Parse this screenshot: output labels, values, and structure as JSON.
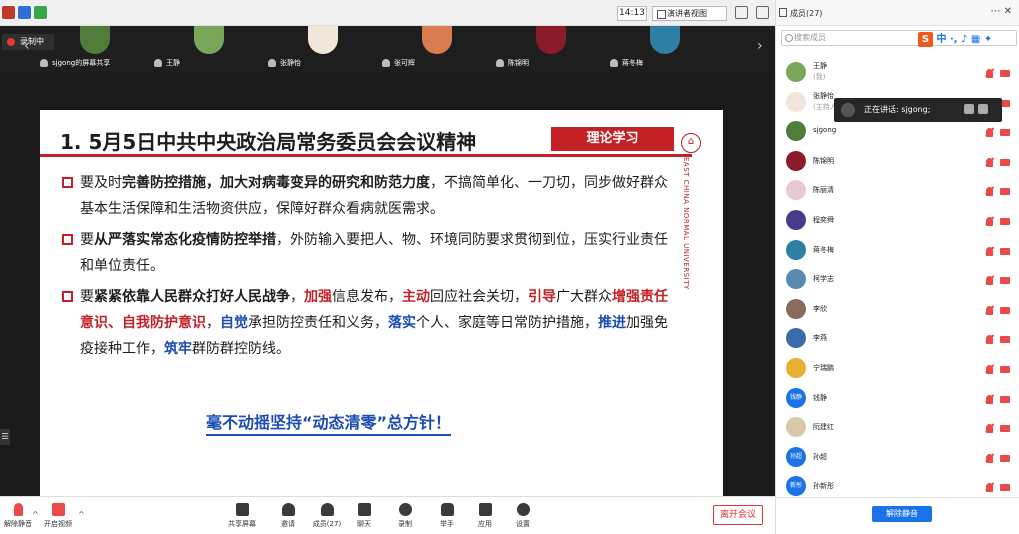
{
  "status": {
    "time": "14:13",
    "view_label": "演讲者视图"
  },
  "recording": {
    "label": "录制中"
  },
  "strip": {
    "tiles": [
      {
        "name": "sjgong的屏幕共享",
        "color": "#4f7c3a"
      },
      {
        "name": "王静",
        "color": "#7aa65a"
      },
      {
        "name": "张静怡",
        "color": "#f2e6d8"
      },
      {
        "name": "张可辉",
        "color": "#d97c4f"
      },
      {
        "name": "陈锦明",
        "color": "#8a1b2b"
      },
      {
        "name": "蒋冬梅",
        "color": "#2d7fa3"
      }
    ]
  },
  "slide": {
    "title": "1. 5月5日中共中央政治局常务委员会会议精神",
    "badge": "理论学习",
    "logo_text": "EAST CHINA NORMAL UNIVERSITY",
    "b1": {
      "p1": "要及时",
      "p2": "完善防控措施，加大对病毒变异的研究和防范力度",
      "p3": "，不搞简单化、一刀切，同步做好群众基本生活保障和生活物资供应，保障好群众看病就医需求。"
    },
    "b2": {
      "p1": "要",
      "p2": "从严落实常态化疫情防控举措",
      "p3": "，外防输入要把人、物、环境同防要求贯彻到位，压实行业责任和单位责任。"
    },
    "b3": {
      "p1": "要",
      "p2": "紧紧依靠人民群众打好人民战争",
      "p3": "，",
      "p4": "加强",
      "p5": "信息发布，",
      "p6": "主动",
      "p7": "回应社会关切，",
      "p8": "引导",
      "p9": "广大群众",
      "p10": "增强责任意识、自我防护意识",
      "p11": "，",
      "p12": "自觉",
      "p13": "承担防控责任和义务，",
      "p14": "落实",
      "p15": "个人、家庭等日常防护措施，",
      "p16": "推进",
      "p17": "加强免疫接种工作，",
      "p18": "筑牢",
      "p19": "群防群控防线。"
    },
    "slogan": "毫不动摇坚持“动态清零”总方针！"
  },
  "toolbar": {
    "mute": "解除静音",
    "video": "开启视频",
    "share": "共享屏幕",
    "invite": "邀请",
    "members": "成员(27)",
    "chat": "聊天",
    "record": "录制",
    "hand": "举手",
    "apps": "应用",
    "settings": "设置",
    "leave": "离开会议"
  },
  "panel": {
    "title": "成员(27)",
    "search_placeholder": "搜索成员",
    "ime": "中",
    "speaking": "正在讲话: sjgong;",
    "mute_btn": "解除静音",
    "members": [
      {
        "name": "王静",
        "role": "(我)",
        "color": "#7aa65a",
        "txt": ""
      },
      {
        "name": "张静怡",
        "role": "(主持人)",
        "color": "#f2e6d8",
        "txt": ""
      },
      {
        "name": "sjgong",
        "role": "",
        "color": "#4f7c3a",
        "txt": ""
      },
      {
        "name": "陈锦明",
        "role": "",
        "color": "#8a1b2b",
        "txt": ""
      },
      {
        "name": "陈丽清",
        "role": "",
        "color": "#e8c8d4",
        "txt": ""
      },
      {
        "name": "程奕舜",
        "role": "",
        "color": "#4a3a8a",
        "txt": ""
      },
      {
        "name": "蒋冬梅",
        "role": "",
        "color": "#2d7fa3",
        "txt": ""
      },
      {
        "name": "柯学志",
        "role": "",
        "color": "#5a8ab0",
        "txt": ""
      },
      {
        "name": "李欣",
        "role": "",
        "color": "#8a6a5a",
        "txt": ""
      },
      {
        "name": "李燕",
        "role": "",
        "color": "#3a6aa8",
        "txt": ""
      },
      {
        "name": "宁瑞鹏",
        "role": "",
        "color": "#e8b030",
        "txt": ""
      },
      {
        "name": "钱静",
        "role": "",
        "color": "#1a73e8",
        "txt": "钱静"
      },
      {
        "name": "阮建红",
        "role": "",
        "color": "#d8c8a8",
        "txt": ""
      },
      {
        "name": "孙超",
        "role": "",
        "color": "#1a73e8",
        "txt": "孙超"
      },
      {
        "name": "孙新彤",
        "role": "",
        "color": "#1a73e8",
        "txt": "新彤"
      }
    ]
  }
}
